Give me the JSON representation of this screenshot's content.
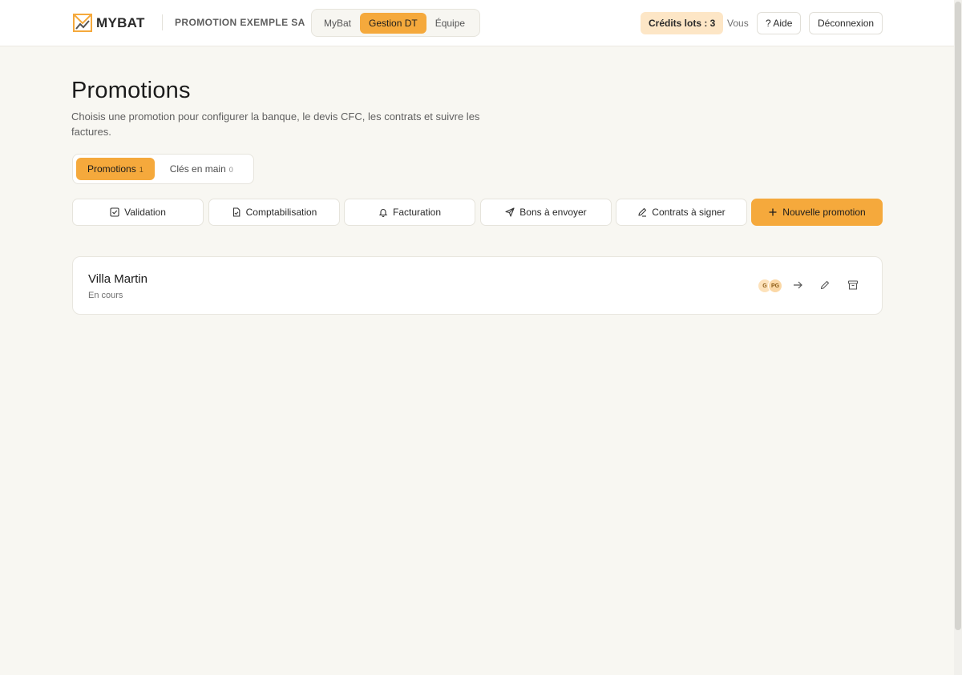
{
  "header": {
    "brand": "MYBAT",
    "org_name": "PROMOTION EXEMPLE SA",
    "nav_tabs": [
      {
        "label": "MyBat",
        "active": false
      },
      {
        "label": "Gestion DT",
        "active": true
      },
      {
        "label": "Équipe",
        "active": false
      }
    ],
    "credits_label": "Crédits lots : 3",
    "user_label": "Vous",
    "help_label": "? Aide",
    "logout_label": "Déconnexion"
  },
  "page": {
    "title": "Promotions",
    "subtitle": "Choisis une promotion pour configurer la banque, le devis CFC, les contrats et suivre les factures."
  },
  "segment": [
    {
      "label": "Promotions",
      "count": "1",
      "active": true
    },
    {
      "label": "Clés en main",
      "count": "0",
      "active": false
    }
  ],
  "actions": [
    {
      "label": "Validation",
      "icon": "check-square-icon"
    },
    {
      "label": "Comptabilisation",
      "icon": "file-check-icon"
    },
    {
      "label": "Facturation",
      "icon": "bell-icon"
    },
    {
      "label": "Bons à envoyer",
      "icon": "send-icon"
    },
    {
      "label": "Contrats à signer",
      "icon": "pen-icon"
    },
    {
      "label": "Nouvelle promotion",
      "icon": "plus-icon"
    }
  ],
  "promotions": [
    {
      "name": "Villa Martin",
      "status": "En cours",
      "avatars": [
        "G",
        "PG"
      ]
    }
  ],
  "colors": {
    "accent": "#f5a93c",
    "background": "#f8f7f2",
    "credits_bg": "#fde6c6"
  }
}
